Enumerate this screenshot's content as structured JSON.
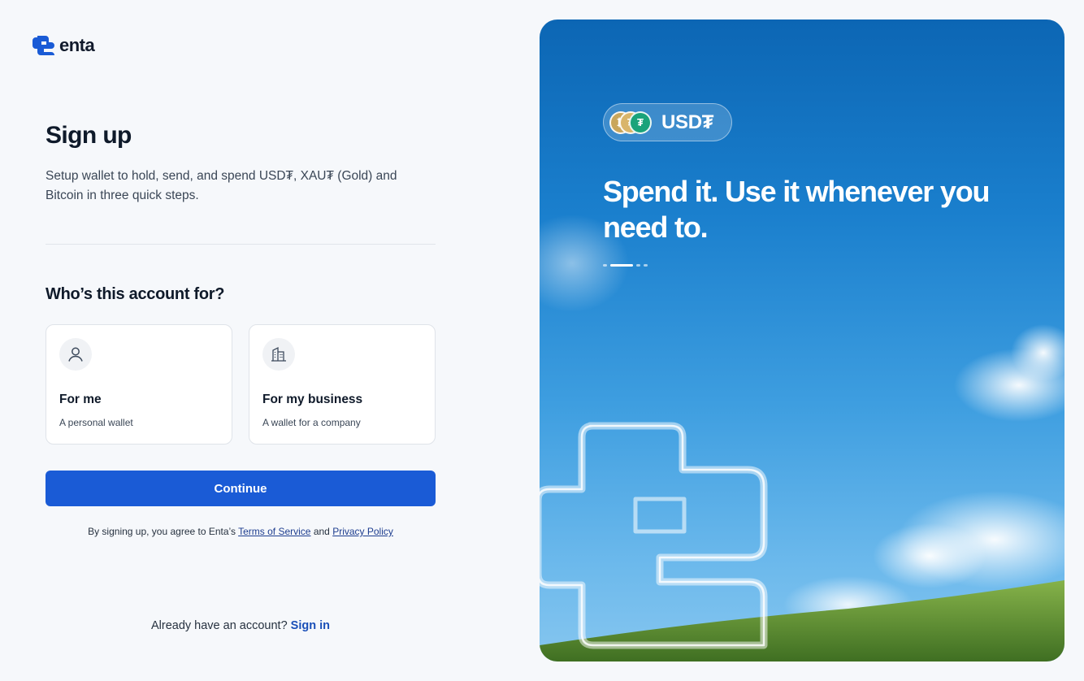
{
  "brand": {
    "name": "enta"
  },
  "signup": {
    "title": "Sign up",
    "subtitle": "Setup wallet to hold, send, and spend USD₮, XAU₮ (Gold) and Bitcoin in three quick steps.",
    "question": "Who’s this account for?",
    "options": [
      {
        "title": "For me",
        "description": "A personal wallet",
        "icon": "user-icon"
      },
      {
        "title": "For my business",
        "description": "A wallet for a company",
        "icon": "building-icon"
      }
    ],
    "continue_label": "Continue",
    "terms": {
      "prefix": "By signing up, you agree to Enta’s",
      "tos_label": "Terms of Service",
      "and": "and",
      "privacy_label": "Privacy Policy"
    },
    "signin": {
      "prompt": "Already have an account?",
      "link_label": "Sign in"
    }
  },
  "hero": {
    "pill_label": "USD₮",
    "headline": "Spend it. Use it whenever you need to.",
    "carousel": {
      "total": 4,
      "active": 1
    }
  },
  "colors": {
    "primary": "#1a5bd6",
    "link": "#1a4fb8",
    "background": "#f6f8fb",
    "sky": "#1a7fcd",
    "grass": "#5a8e2e"
  }
}
